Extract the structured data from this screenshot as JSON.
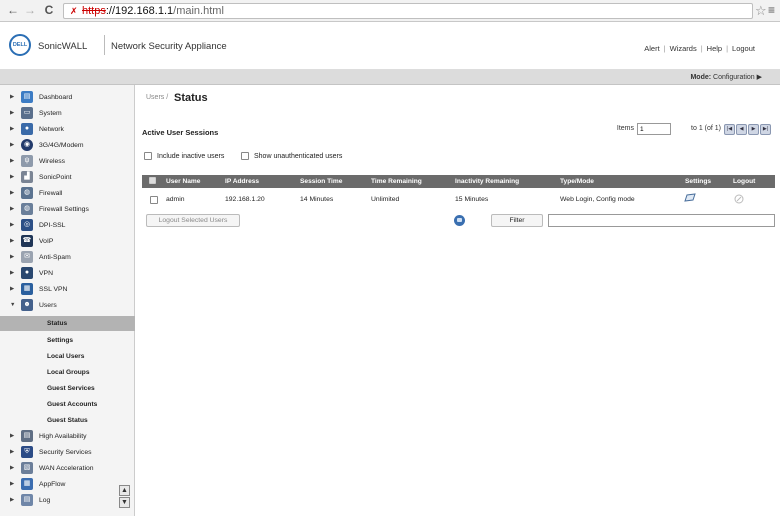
{
  "browser": {
    "url_scheme": "https",
    "url_sep": "://",
    "url_host": "192.168.1.1",
    "url_path": "/main.html",
    "back": "←",
    "forward": "→",
    "reload": "C",
    "star": "☆",
    "menu": "≡"
  },
  "header": {
    "logo": "DELL",
    "brand": "SonicWALL",
    "product": "Network Security Appliance",
    "links": [
      "Alert",
      "Wizards",
      "Help",
      "Logout"
    ],
    "link_sep": "|"
  },
  "mode_bar": {
    "label": "Mode:",
    "value": "Configuration ▶"
  },
  "sidebar": {
    "items": [
      {
        "label": "Dashboard",
        "icon": "dashboard-icon",
        "arrow": "▶"
      },
      {
        "label": "System",
        "icon": "system-icon",
        "arrow": "▶"
      },
      {
        "label": "Network",
        "icon": "network-icon",
        "arrow": "▶"
      },
      {
        "label": "3G/4G/Modem",
        "icon": "modem-icon",
        "arrow": "▶"
      },
      {
        "label": "Wireless",
        "icon": "wireless-icon",
        "arrow": "▶"
      },
      {
        "label": "SonicPoint",
        "icon": "sonicpoint-icon",
        "arrow": "▶"
      },
      {
        "label": "Firewall",
        "icon": "firewall-icon",
        "arrow": "▶"
      },
      {
        "label": "Firewall Settings",
        "icon": "firewall-settings-icon",
        "arrow": "▶"
      },
      {
        "label": "DPI-SSL",
        "icon": "dpi-ssl-icon",
        "arrow": "▶"
      },
      {
        "label": "VoIP",
        "icon": "voip-icon",
        "arrow": "▶"
      },
      {
        "label": "Anti-Spam",
        "icon": "anti-spam-icon",
        "arrow": "▶"
      },
      {
        "label": "VPN",
        "icon": "vpn-icon",
        "arrow": "▶"
      },
      {
        "label": "SSL VPN",
        "icon": "ssl-vpn-icon",
        "arrow": "▶"
      },
      {
        "label": "Users",
        "icon": "users-icon",
        "arrow": "▼"
      }
    ],
    "sub_items": [
      {
        "label": "Status"
      },
      {
        "label": "Settings"
      },
      {
        "label": "Local Users"
      },
      {
        "label": "Local Groups"
      },
      {
        "label": "Guest Services"
      },
      {
        "label": "Guest Accounts"
      },
      {
        "label": "Guest Status"
      }
    ],
    "items_after": [
      {
        "label": "High Availability",
        "icon": "high-availability-icon",
        "arrow": "▶"
      },
      {
        "label": "Security Services",
        "icon": "security-services-icon",
        "arrow": "▶"
      },
      {
        "label": "WAN Acceleration",
        "icon": "wan-acceleration-icon",
        "arrow": "▶"
      },
      {
        "label": "AppFlow",
        "icon": "appflow-icon",
        "arrow": "▶"
      },
      {
        "label": "Log",
        "icon": "log-icon",
        "arrow": "▶"
      }
    ],
    "scroll_up": "▲",
    "scroll_down": "▼"
  },
  "main": {
    "breadcrumb": "Users /",
    "title": "Status",
    "section_title": "Active User Sessions",
    "pager": {
      "items_label": "Items",
      "items_value": "1",
      "range_label": "to 1 (of 1)",
      "buttons": [
        "|◀",
        "◀",
        "▶",
        "▶|"
      ]
    },
    "options": {
      "include_inactive": "Include inactive users",
      "show_unauthenticated": "Show unauthenticated users"
    },
    "table": {
      "headers": [
        "User Name",
        "IP Address",
        "Session Time",
        "Time Remaining",
        "Inactivity Remaining",
        "Type/Mode",
        "Settings",
        "Logout"
      ],
      "rows": [
        {
          "user": "admin",
          "ip": "192.168.1.20",
          "session": "14 Minutes",
          "remaining": "Unlimited",
          "inactivity": "15 Minutes",
          "type": "Web Login, Config mode",
          "settings_icon": "edit-settings-icon",
          "logout_icon": "logout-disabled-icon"
        }
      ]
    },
    "logout_selected": "Logout Selected Users",
    "filter_label": "Filter",
    "filter_value": ""
  }
}
